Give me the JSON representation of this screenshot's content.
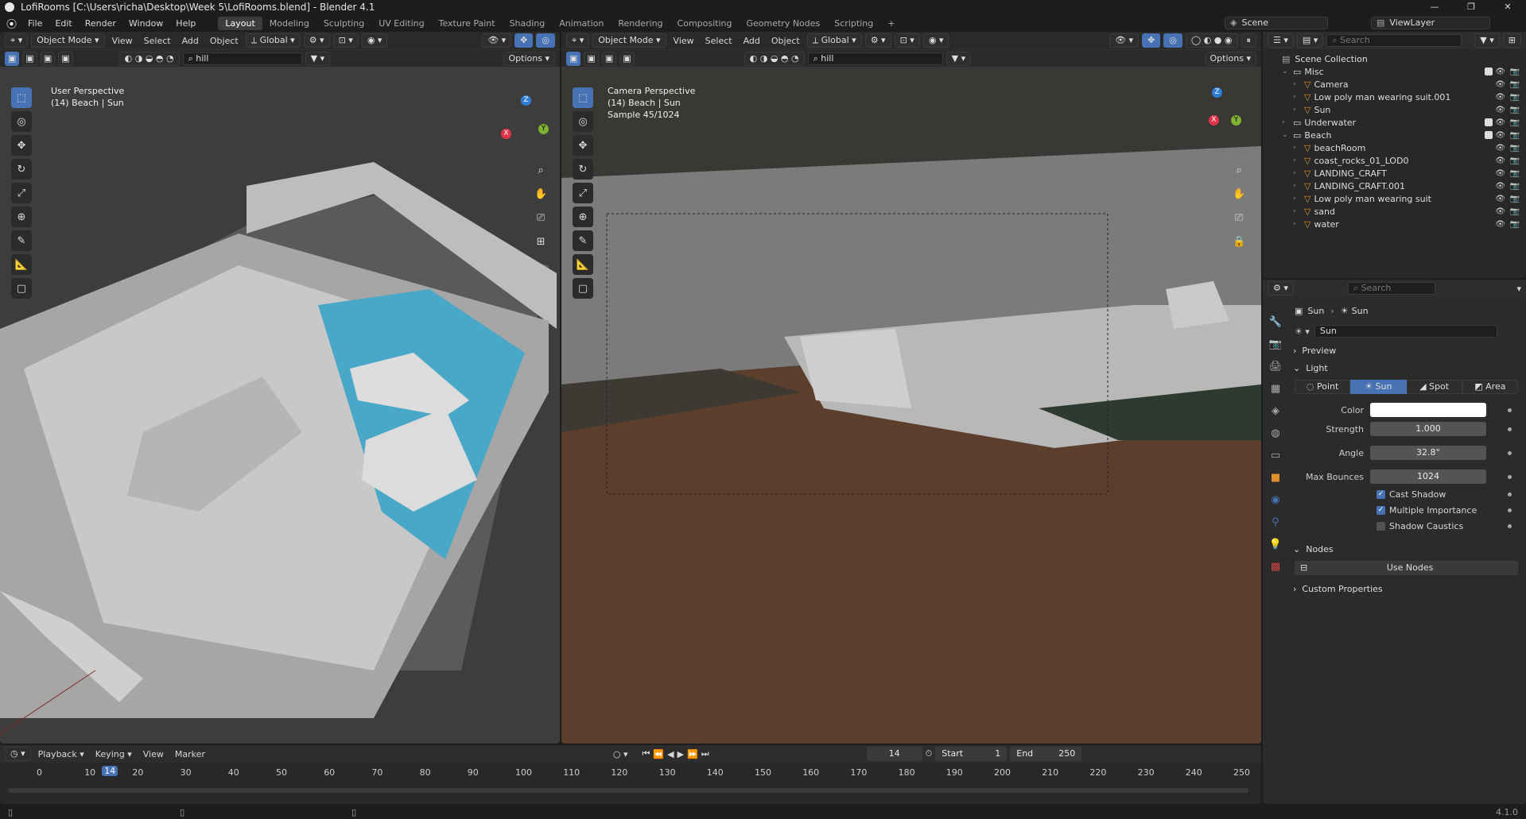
{
  "window": {
    "title": "LofiRooms [C:\\Users\\richa\\Desktop\\Week 5\\LofiRooms.blend] - Blender 4.1",
    "buttons": [
      "—",
      "❐",
      "✕"
    ]
  },
  "menu": {
    "items": [
      "File",
      "Edit",
      "Render",
      "Window",
      "Help"
    ]
  },
  "workspaces": [
    "Layout",
    "Modeling",
    "Sculpting",
    "UV Editing",
    "Texture Paint",
    "Shading",
    "Animation",
    "Rendering",
    "Compositing",
    "Geometry Nodes",
    "Scripting",
    "+"
  ],
  "scene": {
    "label": "Scene",
    "viewlayer": "ViewLayer"
  },
  "viewport_left": {
    "mode": "Object Mode",
    "menus": [
      "View",
      "Select",
      "Add",
      "Object"
    ],
    "transform": "Global",
    "search": "hill",
    "options": "Options",
    "overlay_title": "User Perspective",
    "overlay_sub": "(14) Beach | Sun"
  },
  "viewport_right": {
    "mode": "Object Mode",
    "menus": [
      "View",
      "Select",
      "Add",
      "Object"
    ],
    "transform": "Global",
    "search": "hill",
    "options": "Options",
    "overlay_title": "Camera Perspective",
    "overlay_sub": "(14) Beach | Sun",
    "overlay_sample": "Sample 45/1024"
  },
  "gizmo": {
    "x": "X",
    "y": "Y",
    "z": "Z"
  },
  "outliner": {
    "search_placeholder": "Search",
    "root": "Scene Collection",
    "rows": [
      {
        "indent": 1,
        "label": "Misc",
        "kind": "collection",
        "open": true
      },
      {
        "indent": 2,
        "label": "Camera",
        "kind": "object"
      },
      {
        "indent": 2,
        "label": "Low poly man wearing suit.001",
        "kind": "object"
      },
      {
        "indent": 2,
        "label": "Sun",
        "kind": "object"
      },
      {
        "indent": 1,
        "label": "Underwater",
        "kind": "collection",
        "open": false
      },
      {
        "indent": 1,
        "label": "Beach",
        "kind": "collection",
        "open": true
      },
      {
        "indent": 2,
        "label": "beachRoom",
        "kind": "object"
      },
      {
        "indent": 2,
        "label": "coast_rocks_01_LOD0",
        "kind": "object"
      },
      {
        "indent": 2,
        "label": "LANDING_CRAFT",
        "kind": "object"
      },
      {
        "indent": 2,
        "label": "LANDING_CRAFT.001",
        "kind": "object"
      },
      {
        "indent": 2,
        "label": "Low poly man wearing suit",
        "kind": "object"
      },
      {
        "indent": 2,
        "label": "sand",
        "kind": "object"
      },
      {
        "indent": 2,
        "label": "water",
        "kind": "object"
      }
    ]
  },
  "properties": {
    "search_placeholder": "Search",
    "breadcrumb": [
      "Sun",
      "Sun"
    ],
    "datablock": "Sun",
    "sections": {
      "preview": "Preview",
      "light": "Light",
      "nodes": "Nodes",
      "custom": "Custom Properties"
    },
    "light_types": [
      "Point",
      "Sun",
      "Spot",
      "Area"
    ],
    "fields": [
      {
        "label": "Color",
        "value": ""
      },
      {
        "label": "Strength",
        "value": "1.000"
      },
      {
        "label": "Angle",
        "value": "32.8°"
      },
      {
        "label": "Max Bounces",
        "value": "1024"
      }
    ],
    "checks": [
      {
        "label": "Cast Shadow",
        "checked": true
      },
      {
        "label": "Multiple Importance",
        "checked": true
      },
      {
        "label": "Shadow Caustics",
        "checked": false
      }
    ],
    "use_nodes": "Use Nodes",
    "color": "#ffffff"
  },
  "timeline": {
    "menus": [
      "Playback",
      "Keying",
      "View",
      "Marker"
    ],
    "current_frame": "14",
    "start_label": "Start",
    "start": "1",
    "end_label": "End",
    "end": "250",
    "ticks": [
      "0",
      "10",
      "20",
      "30",
      "40",
      "50",
      "60",
      "70",
      "80",
      "90",
      "100",
      "110",
      "120",
      "130",
      "140",
      "150",
      "160",
      "170",
      "180",
      "190",
      "200",
      "210",
      "220",
      "230",
      "240",
      "250"
    ],
    "playhead": "14"
  },
  "status": {
    "version": "4.1.0"
  },
  "colors": {
    "accent": "#4772b3",
    "object_orange": "#e0902d",
    "bg": "#1d1d1d"
  }
}
